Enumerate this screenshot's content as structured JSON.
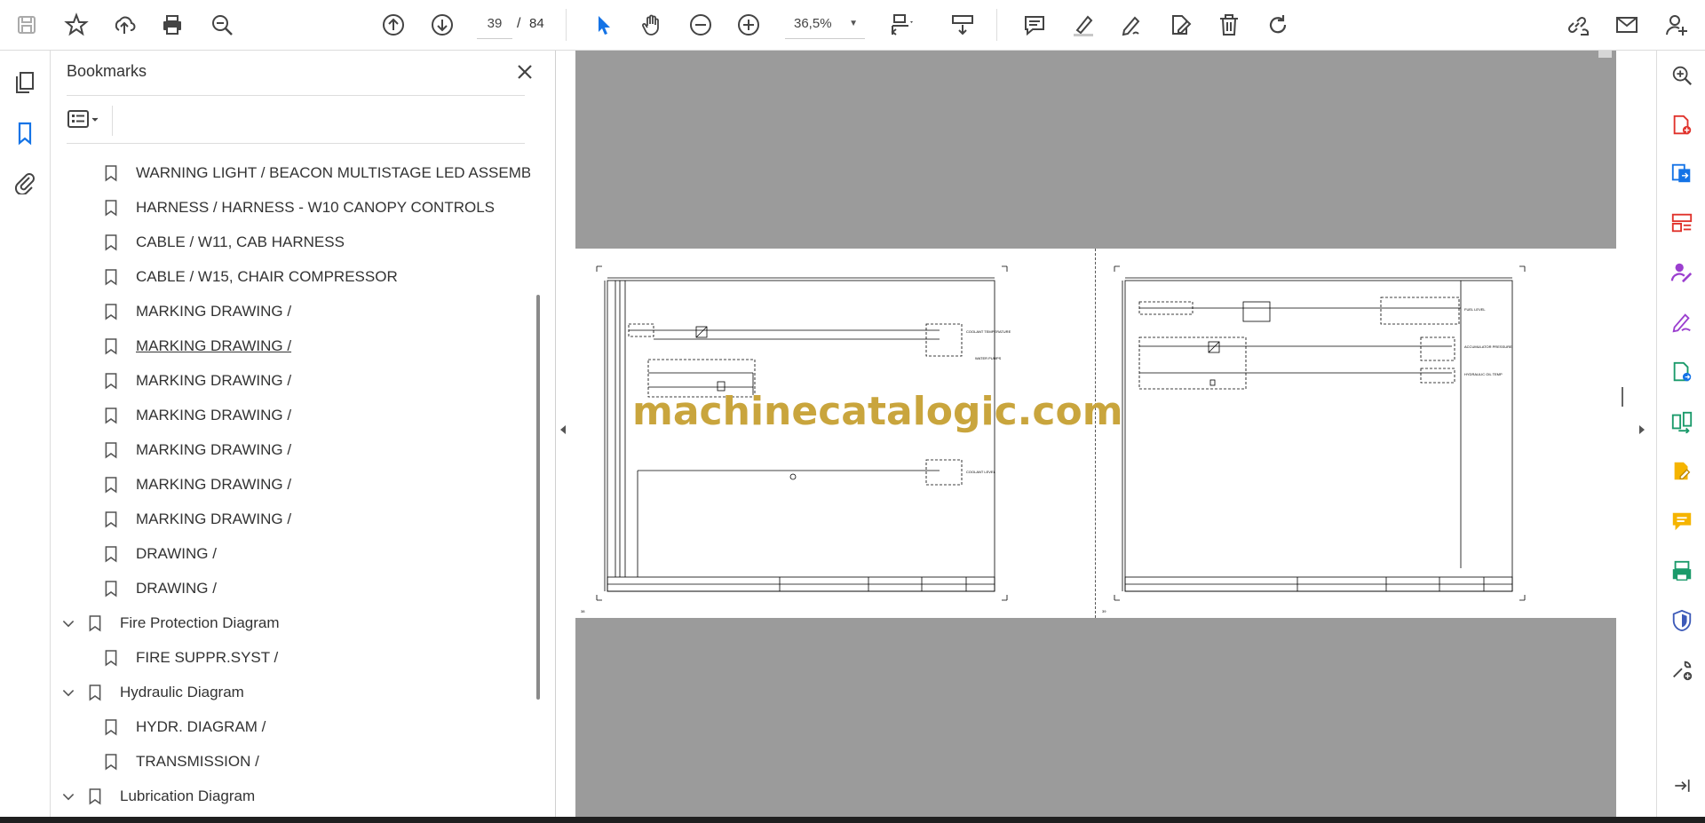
{
  "toolbar": {
    "icons": [
      "save-icon",
      "star-icon",
      "upload-icon",
      "print-icon",
      "zoom-search-icon",
      "prev-page-icon",
      "next-page-icon",
      "select-icon",
      "hand-icon",
      "zoom-out-icon",
      "zoom-in-icon",
      "fit-page-icon",
      "scroll-mode-icon",
      "comment-icon",
      "highlight-icon",
      "sign-icon",
      "edit-pdf-icon",
      "delete-icon",
      "rotate-icon",
      "share-link-icon",
      "email-icon",
      "account-icon"
    ],
    "current_page": "39",
    "page_separator": "/",
    "total_pages": "84",
    "zoom": "36,5%"
  },
  "panel": {
    "title": "Bookmarks",
    "items": [
      {
        "label": "WARNING LIGHT / BEACON MULTISTAGE LED ASSEMBLY",
        "level": 2
      },
      {
        "label": "HARNESS / HARNESS - W10 CANOPY CONTROLS",
        "level": 2
      },
      {
        "label": "CABLE / W11, CAB HARNESS",
        "level": 2
      },
      {
        "label": "CABLE / W15, CHAIR COMPRESSOR",
        "level": 2
      },
      {
        "label": "MARKING DRAWING /",
        "level": 2
      },
      {
        "label": "MARKING DRAWING /",
        "level": 2,
        "hovered": true
      },
      {
        "label": "MARKING DRAWING /",
        "level": 2
      },
      {
        "label": "MARKING DRAWING /",
        "level": 2
      },
      {
        "label": "MARKING DRAWING /",
        "level": 2
      },
      {
        "label": "MARKING DRAWING /",
        "level": 2
      },
      {
        "label": "MARKING DRAWING /",
        "level": 2
      },
      {
        "label": "DRAWING /",
        "level": 2
      },
      {
        "label": "DRAWING /",
        "level": 2
      },
      {
        "label": "Fire Protection Diagram",
        "level": 1
      },
      {
        "label": "FIRE SUPPR.SYST /",
        "level": 2
      },
      {
        "label": "Hydraulic Diagram",
        "level": 1
      },
      {
        "label": "HYDR. DIAGRAM /",
        "level": 2
      },
      {
        "label": "TRANSMISSION /",
        "level": 2
      },
      {
        "label": "Lubrication Diagram",
        "level": 1
      }
    ]
  },
  "document": {
    "watermark": "machinecatalogic.com",
    "left_page_number": "38",
    "right_page_number": "39",
    "left_labels": [
      "COOLANT TEMPERATURE",
      "WATER PUMPS",
      "COOLANT LEVEL"
    ],
    "right_labels": [
      "FUEL LEVEL",
      "ACCUMULATOR PRESSURE",
      "HYDRAULIC OIL TEMP"
    ]
  },
  "rightrail": {
    "icons": [
      "zoom-tool-icon",
      "create-pdf-icon",
      "export-pdf-icon",
      "organize-pages-icon",
      "request-signature-icon",
      "fill-sign-icon",
      "scan-ocr-icon",
      "compare-icon",
      "edit-pdf-icon",
      "comment-icon",
      "combine-files-icon",
      "protect-icon",
      "more-tools-icon",
      "collapse-panel-icon"
    ]
  }
}
